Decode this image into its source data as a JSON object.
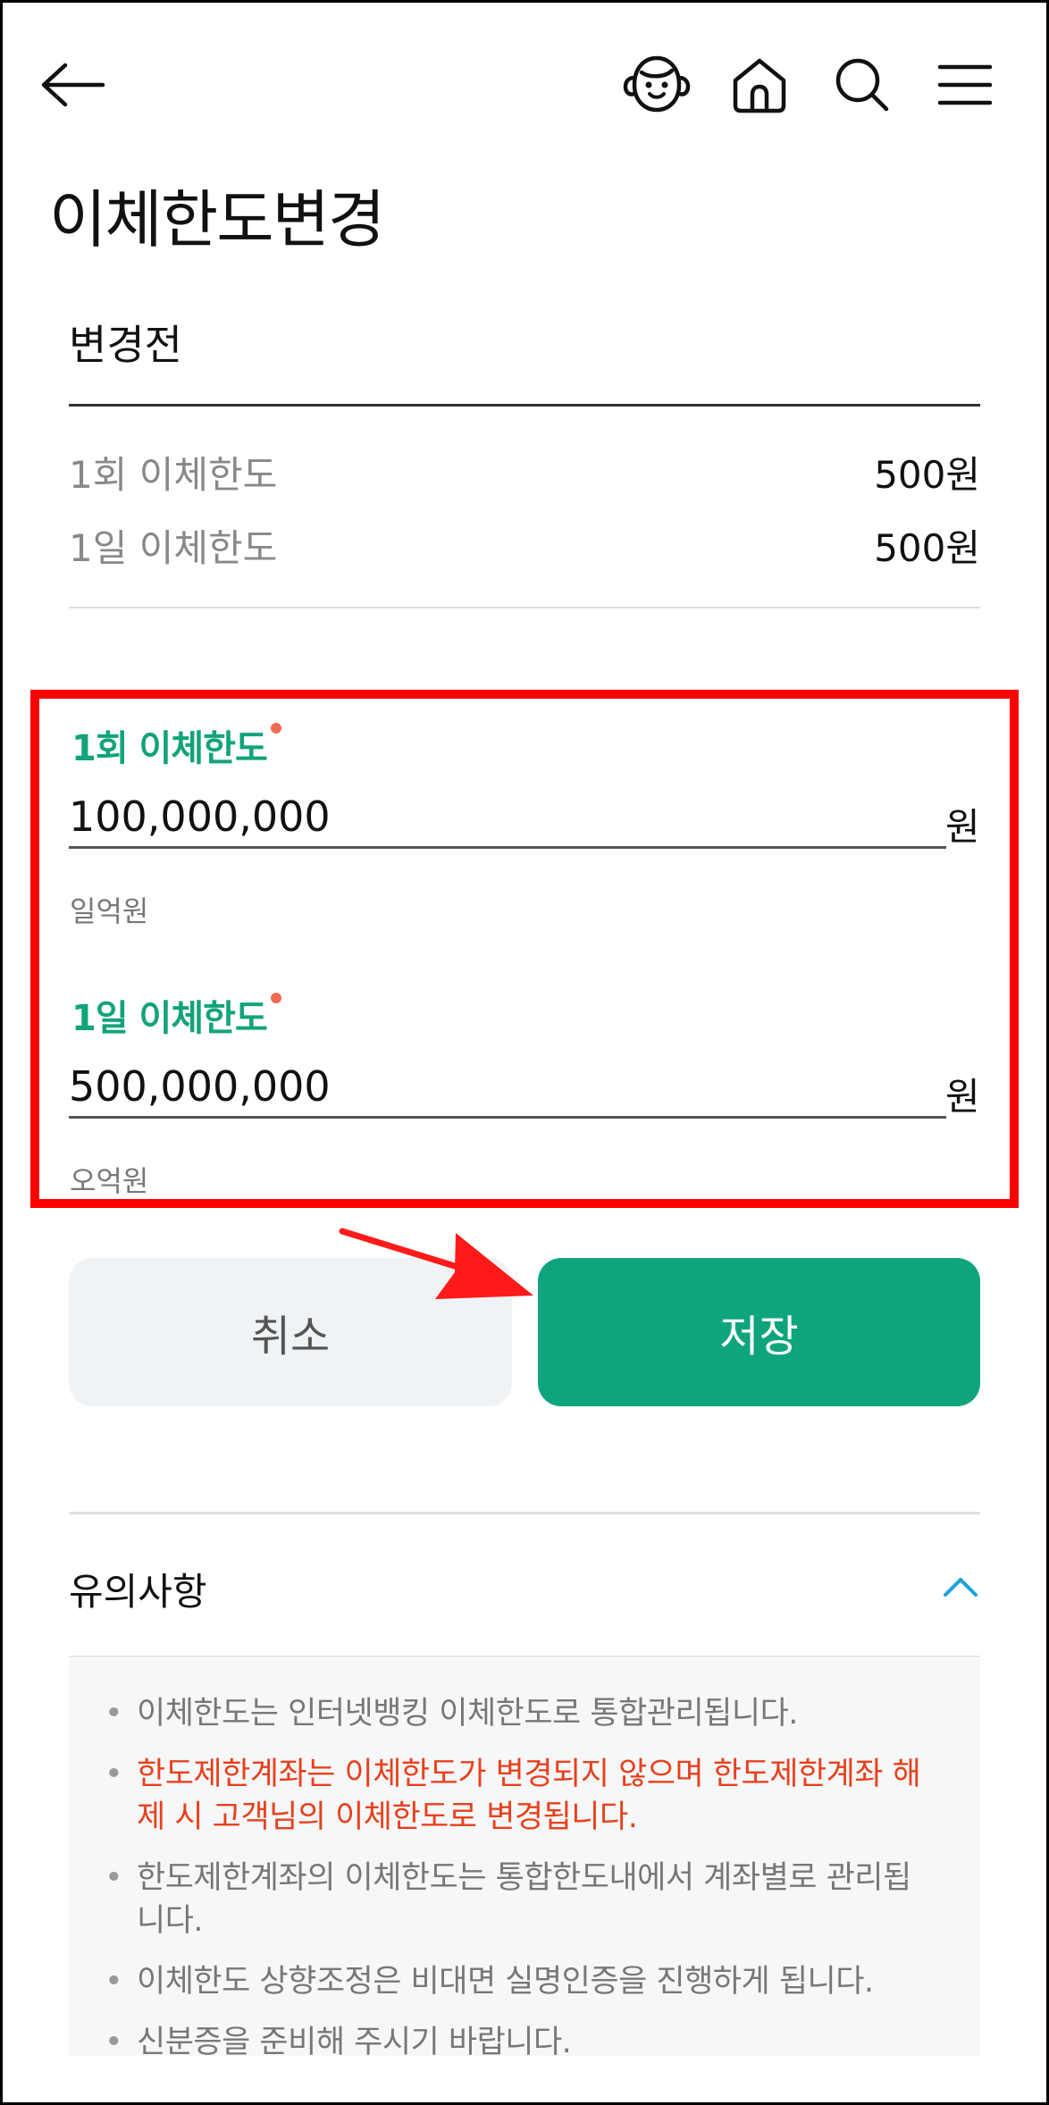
{
  "page": {
    "title": "이체한도변경"
  },
  "before": {
    "section_label": "변경전",
    "rows": [
      {
        "label": "1회 이체한도",
        "value": "500원"
      },
      {
        "label": "1일 이체한도",
        "value": "500원"
      }
    ]
  },
  "form": {
    "per_transfer": {
      "label": "1회 이체한도",
      "value": "100,000,000",
      "unit": "원",
      "hint": "일억원"
    },
    "per_day": {
      "label": "1일 이체한도",
      "value": "500,000,000",
      "unit": "원",
      "hint": "오억원"
    }
  },
  "buttons": {
    "cancel": "취소",
    "save": "저장"
  },
  "notice": {
    "title": "유의사항",
    "items": [
      "이체한도는 인터넷뱅킹 이체한도로 통합관리됩니다.",
      "한도제한계좌는 이체한도가 변경되지 않으며 한도제한계좌 해제 시 고객님의 이체한도로 변경됩니다.",
      "한도제한계좌의 이체한도는 통합한도내에서 계좌별로 관리됩니다.",
      "이체한도 상향조정은 비대면 실명인증을 진행하게 됩니다.",
      "신분증을 준비해 주시기 바랍니다."
    ]
  },
  "colors": {
    "accent": "#0ea57d",
    "label_green": "#12a37a",
    "warning": "#e8401c",
    "highlight": "#ff0000"
  },
  "icons": [
    "back-arrow-icon",
    "chatbot-icon",
    "home-icon",
    "search-icon",
    "menu-icon",
    "chevron-up-icon"
  ]
}
